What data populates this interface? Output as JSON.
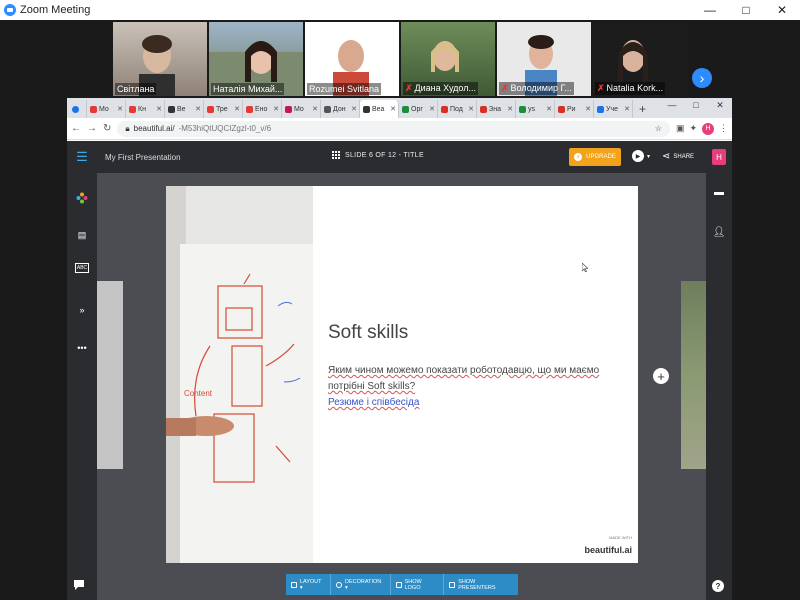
{
  "zoom": {
    "title": "Zoom Meeting",
    "window_controls": [
      "—",
      "□",
      "✕"
    ],
    "participants": [
      {
        "name": "Світлана",
        "muted": false
      },
      {
        "name": "Наталія Михай...",
        "muted": false
      },
      {
        "name": "Rozumei Svitlana",
        "muted": false
      },
      {
        "name": "Диана Худол...",
        "muted": true
      },
      {
        "name": "Володимир Г...",
        "muted": true
      },
      {
        "name": "Natalia Kork...",
        "muted": true
      }
    ],
    "next_arrow": "›"
  },
  "browser": {
    "tabs": [
      {
        "label": "Мо",
        "color": "#e53935"
      },
      {
        "label": "Кн",
        "color": "#e53935"
      },
      {
        "label": "Be",
        "color": "#333333"
      },
      {
        "label": "Тре",
        "color": "#e53935"
      },
      {
        "label": "Ено",
        "color": "#e53935"
      },
      {
        "label": "Мо",
        "color": "#c2185b"
      },
      {
        "label": "Дон",
        "color": "#555555"
      },
      {
        "label": "Bea",
        "color": "#333333",
        "active": true
      },
      {
        "label": "Орг",
        "color": "#1e8e3e"
      },
      {
        "label": "Под",
        "color": "#d93025"
      },
      {
        "label": "Зна",
        "color": "#d93025"
      },
      {
        "label": "ys",
        "color": "#1e8e3e"
      },
      {
        "label": "Ри",
        "color": "#d93025"
      },
      {
        "label": "Уче",
        "color": "#1a73e8"
      }
    ],
    "new_tab": "+",
    "tab_controls": [
      "—",
      "□",
      "✕"
    ],
    "url_host": "beautiful.ai/",
    "url_path": "-M53hiQtUQCIZgzl-t0_v/6",
    "profile_initial": "H"
  },
  "app": {
    "presentation_title": "My First Presentation",
    "slide_indicator": "SLIDE 6 OF 12 - TITLE",
    "upgrade_label": "UPGRADE",
    "share_label": "SHARE",
    "user_initial": "H",
    "slide": {
      "heading": "Soft skills",
      "body_line1": "Яким чином можемо показати роботодавцю, що ми маємо потрібні Soft skills?",
      "body_line2": "Резюме і співбесіда",
      "made_with": "MADE WITH",
      "brand": "beautiful.ai"
    },
    "bottom_toolbar": [
      "LAYOUT ▾",
      "DECORATION ▾",
      "SHOW LOGO",
      "SHOW PRESENTERS"
    ],
    "add_slide": "+"
  }
}
